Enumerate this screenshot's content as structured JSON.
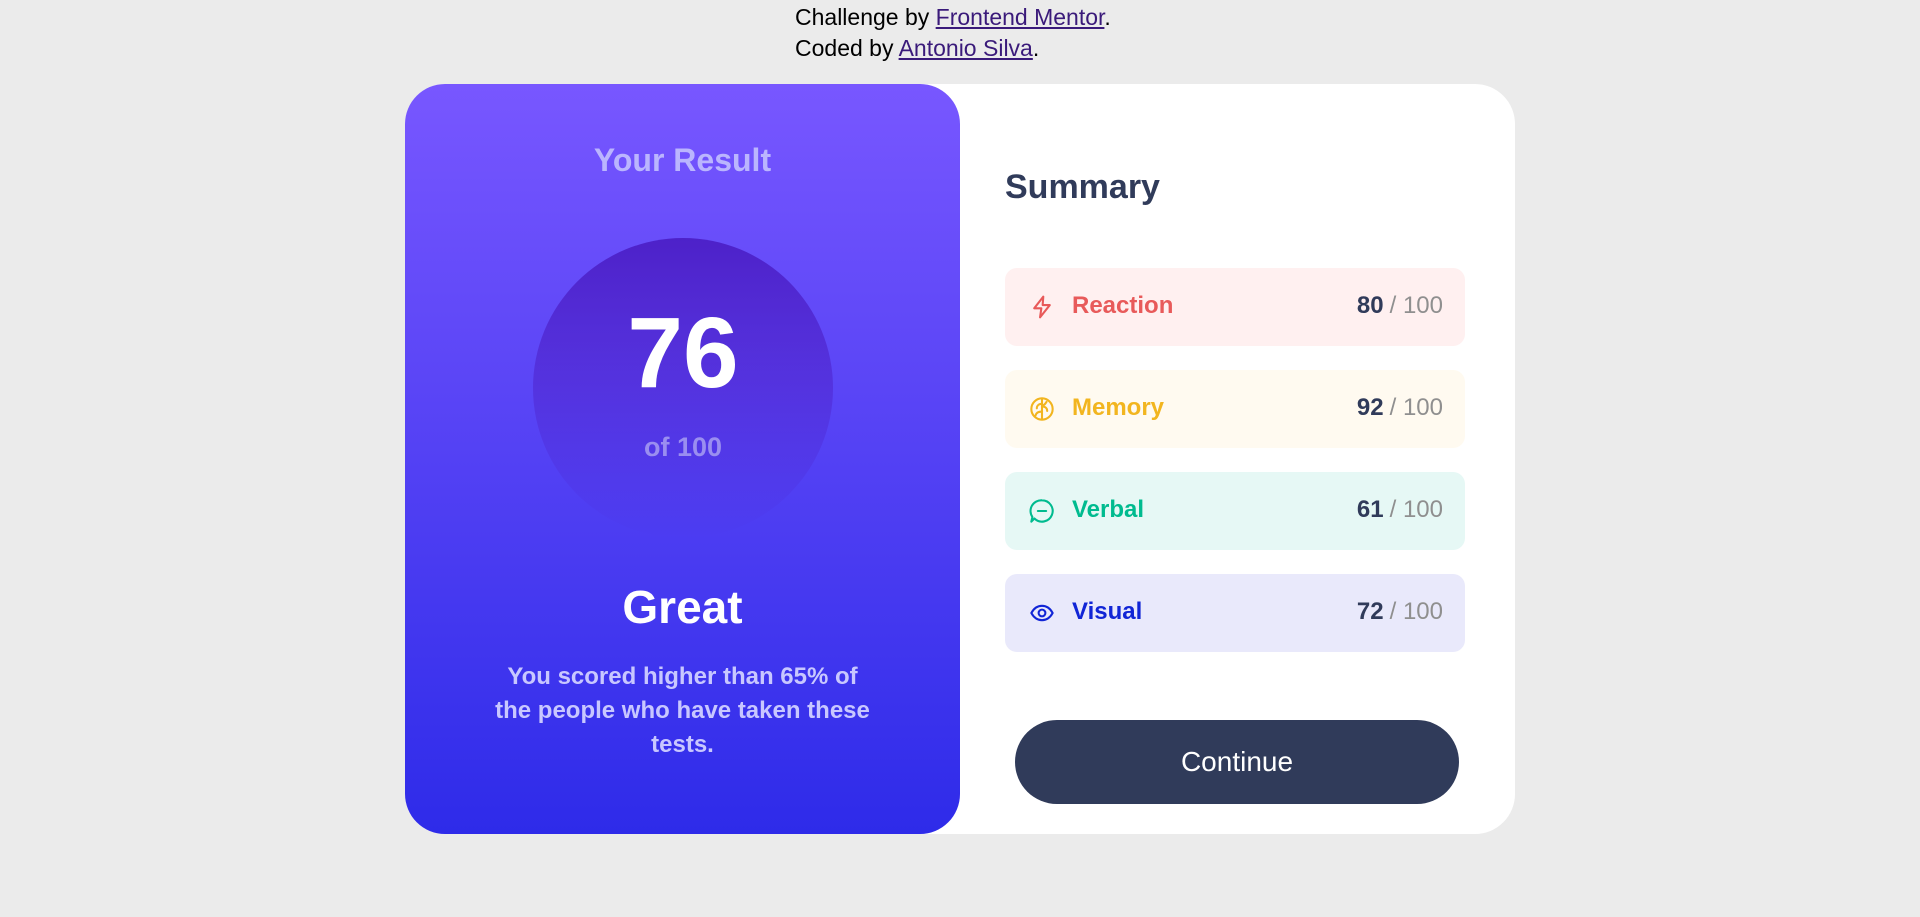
{
  "attribution": {
    "challenge_prefix": "Challenge by ",
    "challenge_link": "Frontend Mentor",
    "challenge_suffix": ".",
    "coded_prefix": "Coded by ",
    "coded_link": "Antonio Silva",
    "coded_suffix": "."
  },
  "result": {
    "title": "Your Result",
    "score": "76",
    "of_label": "of 100",
    "verdict": "Great",
    "description": "You scored higher than 65% of the people who have taken these tests."
  },
  "summary": {
    "title": "Summary",
    "items": [
      {
        "label": "Reaction",
        "score": "80",
        "max": "/ 100",
        "color": "#e85a5a",
        "icon": "lightning-icon"
      },
      {
        "label": "Memory",
        "score": "92",
        "max": "/ 100",
        "color": "#f2b51f",
        "icon": "brain-icon"
      },
      {
        "label": "Verbal",
        "score": "61",
        "max": "/ 100",
        "color": "#00bb8f",
        "icon": "chat-icon"
      },
      {
        "label": "Visual",
        "score": "72",
        "max": "/ 100",
        "color": "#1125d6",
        "icon": "eye-icon"
      }
    ],
    "continue_label": "Continue"
  }
}
